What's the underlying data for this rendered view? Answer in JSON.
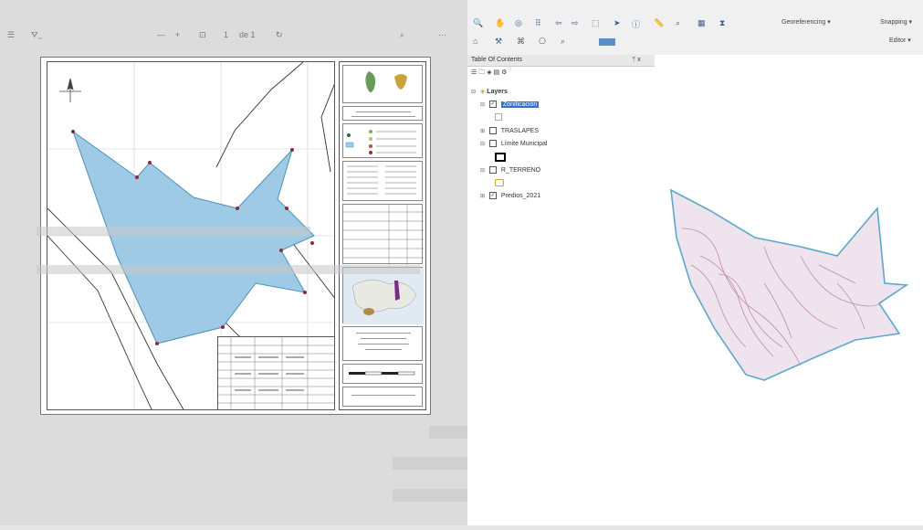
{
  "pdf_viewer": {
    "page_indicator": "de 1",
    "zoom_minus": "—",
    "zoom_plus": "+"
  },
  "map_sheet": {
    "coordinate_table_label": "Cuadro de coordenadas"
  },
  "arcmap": {
    "georeferencing_label": "Georeferencing ▾",
    "snapping_label": "Snapping ▾",
    "editor_label": "Editor ▾",
    "toc_title": "Table Of Contents",
    "toc_pin": "ᛘ x",
    "layers": [
      {
        "name": "Layers",
        "checked": true,
        "root": true
      },
      {
        "name": "Zonificación",
        "checked": true,
        "selected": true
      },
      {
        "name": "TRASLAPES",
        "checked": false
      },
      {
        "name": "Límite Municipal",
        "checked": false
      },
      {
        "name": "R_TERRENO",
        "checked": false
      },
      {
        "name": "Predios_2021",
        "checked": true
      }
    ]
  },
  "colors": {
    "parcel_fill": "#9ecae6",
    "parcel_outline": "#4a90b8",
    "arc_outline": "#5aa9c9",
    "zoning_lines": "#c08ab0"
  }
}
